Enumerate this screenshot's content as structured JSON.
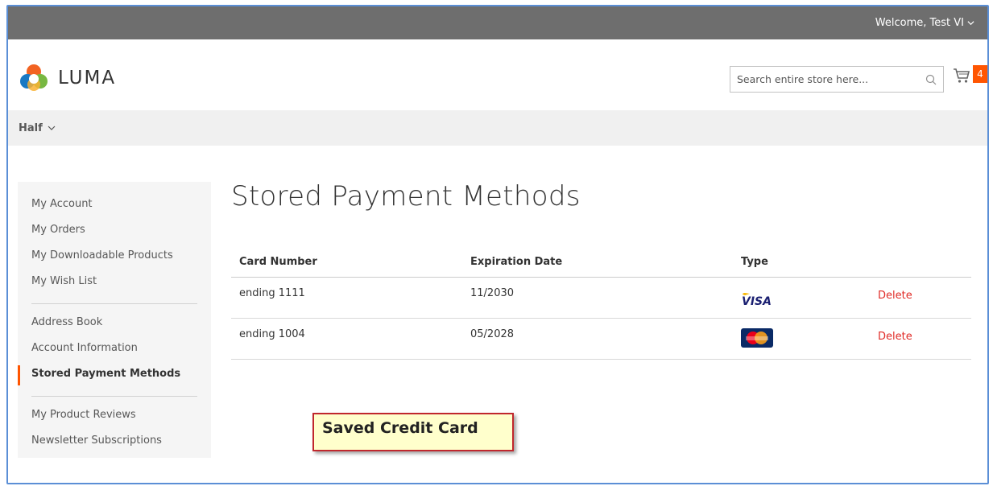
{
  "topbar": {
    "welcome": "Welcome, Test VI"
  },
  "header": {
    "logo_text": "LUMA",
    "search_placeholder": "Search entire store here...",
    "cart_count": "4"
  },
  "nav": {
    "item": "Half"
  },
  "sidebar": {
    "groups": [
      [
        "My Account",
        "My Orders",
        "My Downloadable Products",
        "My Wish List"
      ],
      [
        "Address Book",
        "Account Information",
        "Stored Payment Methods"
      ],
      [
        "My Product Reviews",
        "Newsletter Subscriptions"
      ]
    ],
    "active": "Stored Payment Methods"
  },
  "main": {
    "title": "Stored Payment Methods",
    "columns": [
      "Card Number",
      "Expiration Date",
      "Type"
    ],
    "rows": [
      {
        "card": "ending 1111",
        "expiry": "11/2030",
        "type_icon": "visa-icon",
        "action": "Delete"
      },
      {
        "card": "ending 1004",
        "expiry": "05/2028",
        "type_icon": "mastercard-icon",
        "action": "Delete"
      }
    ]
  },
  "callout": {
    "text": "Saved Credit Card"
  },
  "colors": {
    "accent": "#ff5501",
    "delete": "#e02b27",
    "topbar": "#6e6e6e",
    "frame": "#5b8fd6"
  }
}
